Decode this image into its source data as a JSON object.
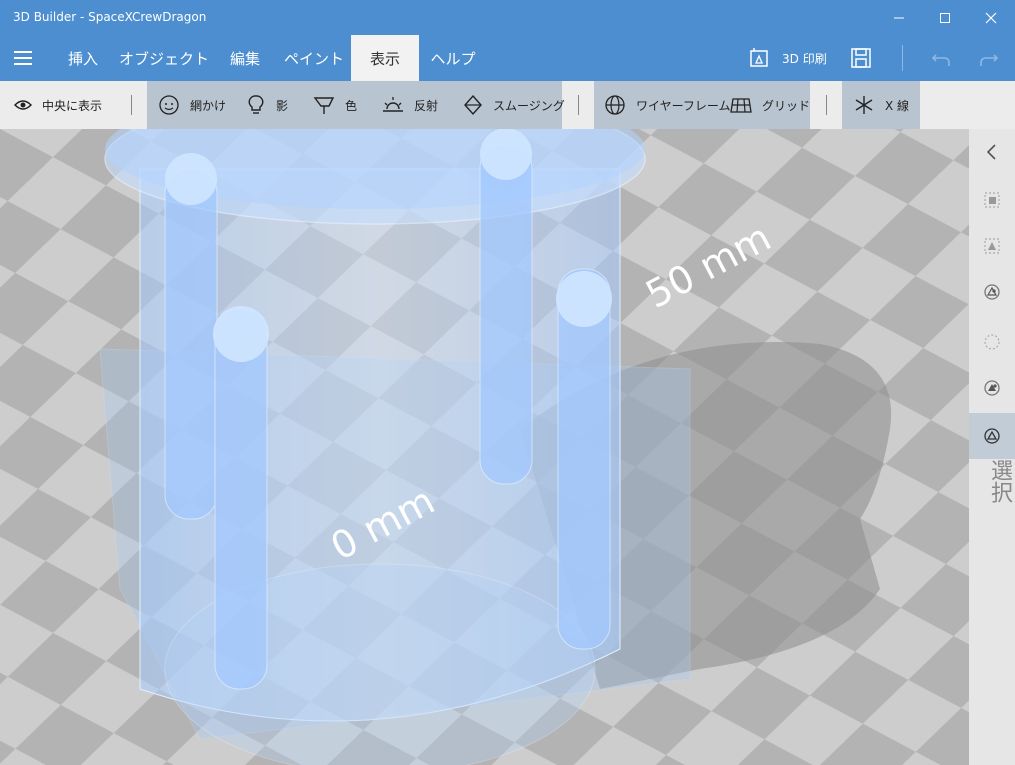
{
  "window": {
    "title": "3D Builder - SpaceXCrewDragon"
  },
  "menu": {
    "items": [
      {
        "label": "挿入"
      },
      {
        "label": "オブジェクト"
      },
      {
        "label": "編集"
      },
      {
        "label": "ペイント"
      },
      {
        "label": "表示"
      },
      {
        "label": "ヘルプ"
      }
    ],
    "active": "表示",
    "print_label": "3D 印刷"
  },
  "toolbar": {
    "center_view": "中央に表示",
    "mesh": "網かけ",
    "shadow": "影",
    "color": "色",
    "reflection": "反射",
    "smoothing": "スムージング",
    "wireframe": "ワイヤーフレーム",
    "grid": "グリッド",
    "xray": "X 線"
  },
  "viewport": {
    "label_0mm": "0 mm",
    "label_50mm": "50 mm"
  },
  "right_panel": {
    "label": "選択"
  },
  "colors": {
    "accent": "#4c8ed0",
    "toolbar_group": "#b8c4d0",
    "floor_dark": "#b3b3b3",
    "floor_light": "#cdcdcd",
    "model": "#9cc8ff"
  }
}
